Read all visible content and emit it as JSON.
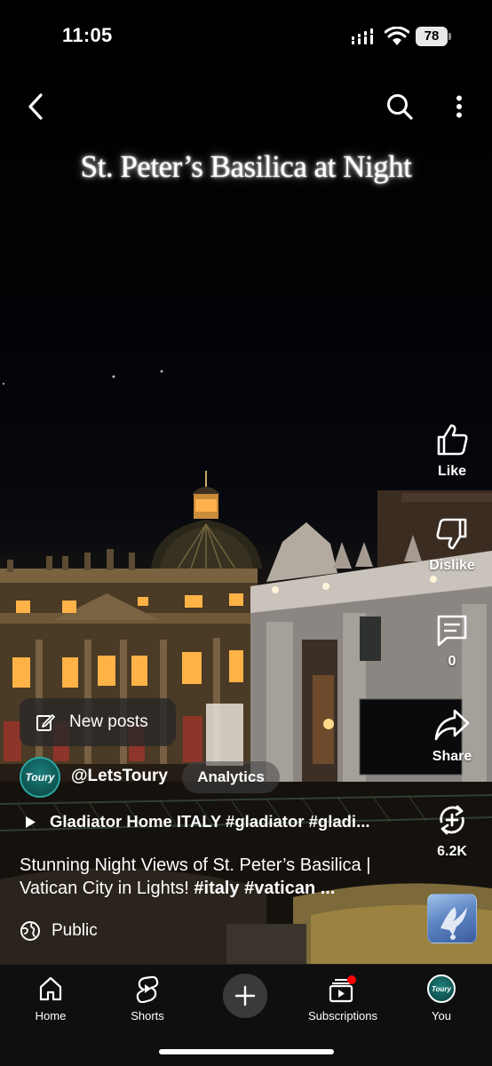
{
  "status_bar": {
    "time": "11:05",
    "battery": "78"
  },
  "overlay_title": "St. Peter’s Basilica at Night",
  "actions": {
    "like": {
      "label": "Like",
      "icon": "thumbs-up-icon"
    },
    "dislike": {
      "label": "Dislike",
      "icon": "thumbs-down-icon"
    },
    "comments": {
      "label": "0",
      "icon": "comment-icon"
    },
    "share": {
      "label": "Share",
      "icon": "share-icon"
    },
    "remix": {
      "label": "6.2K",
      "icon": "remix-icon"
    }
  },
  "new_posts": {
    "label": "New posts",
    "icon": "edit-icon"
  },
  "channel": {
    "avatar_text": "Toury",
    "handle": "@LetsToury",
    "analytics_label": "Analytics"
  },
  "music": {
    "label": "Gladiator Home ITALY #gladiator #gladi..."
  },
  "description": {
    "text": "Stunning Night Views of St. Peter’s Basilica | Vatican City in Lights!",
    "tags": "#italy #vatican ..."
  },
  "visibility": {
    "label": "Public",
    "icon": "globe-icon"
  },
  "nav": {
    "home": "Home",
    "shorts": "Shorts",
    "create_icon": "plus-icon",
    "subscriptions": "Subscriptions",
    "you": "You",
    "you_avatar_text": "Toury"
  },
  "colors": {
    "accent_red": "#ff0000",
    "nav_bg": "#0f0f0f",
    "channel_teal": "#1d7f7b"
  }
}
